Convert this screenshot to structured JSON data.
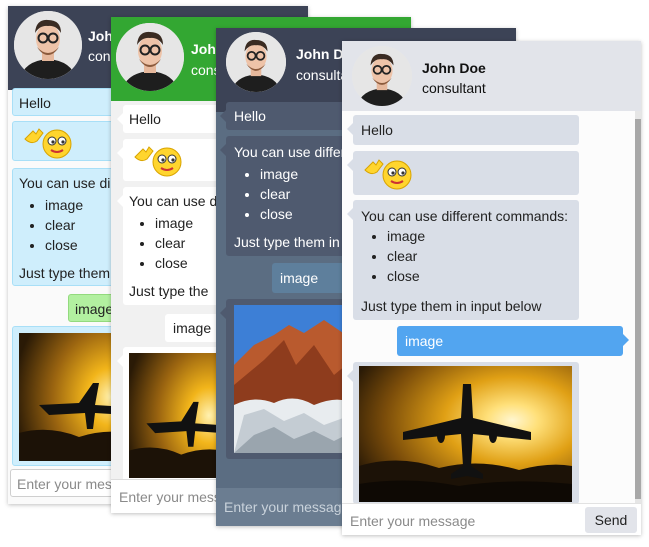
{
  "contact": {
    "name": "John Doe",
    "name_short": "John",
    "name_mid": "John D",
    "role": "consultant",
    "role_short": "consu",
    "role_mid": "consultan"
  },
  "messages": {
    "hello": "Hello",
    "commands_full": "You can use different commands:",
    "commands_c1": "You can use di",
    "commands_c2": "You can use d",
    "commands_c3": "You can use differ",
    "commands": [
      "image",
      "clear",
      "close"
    ],
    "hint_full": "Just type them in input below",
    "hint_c1": "Just type them",
    "hint_c2": "Just type the",
    "hint_c3": "Just type them in",
    "image_cmd": "image"
  },
  "input": {
    "placeholder": "Enter your message",
    "placeholder_c1": "Enter your mes",
    "placeholder_c2": "Enter your mess",
    "placeholder_c3": "Enter your message",
    "send_label": "Send"
  },
  "themes": {
    "light_blue": {
      "header": "#3c4356",
      "user_bubble": "#b2f0a0",
      "bot_bubble": "#cfeefc"
    },
    "green": {
      "header": "#33a732",
      "bot_bubble": "#ffffff",
      "user_bubble": "#ffffff"
    },
    "dark": {
      "header": "#3c4356",
      "bot_bubble": "#4f5a6f",
      "user_bubble": "#5e7f9c",
      "background": "#5b6d82"
    },
    "grey": {
      "header": "#e2e4ea",
      "bot_bubble": "#d9dee7",
      "user_bubble": "#52a5f0"
    }
  },
  "icons": {
    "emoji": "waving-smiley-icon"
  }
}
